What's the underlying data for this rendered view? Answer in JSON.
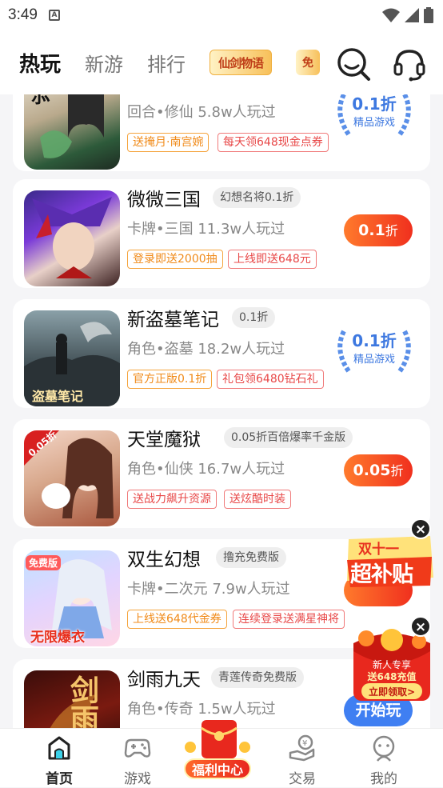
{
  "status_bar": {
    "time": "3:49"
  },
  "top_nav": {
    "tabs": [
      "热玩",
      "新游",
      "排行"
    ],
    "banner_1_text": "仙剑物语",
    "banner_2_text": "免"
  },
  "games": [
    {
      "name": "",
      "tag": "",
      "meta": "回合•修仙  5.8w人玩过",
      "promos": [
        "送掩月·南宫婉",
        "每天领648现金点券"
      ],
      "badge": {
        "value": "0.1折",
        "label": "精品游戏"
      }
    },
    {
      "name": "微微三国",
      "tag": "幻想名将0.1折",
      "meta": "卡牌•三国  11.3w人玩过",
      "promos": [
        "登录即送2000抽",
        "上线即送648元"
      ],
      "button": {
        "value": "0.1",
        "unit": "折"
      }
    },
    {
      "name": "新盗墓笔记",
      "tag": "0.1折",
      "meta": "角色•盗墓  18.2w人玩过",
      "promos": [
        "官方正版0.1折",
        "礼包领6480钻石礼"
      ],
      "badge": {
        "value": "0.1折",
        "label": "精品游戏"
      },
      "thumb_text": "盗墓笔记"
    },
    {
      "name": "天堂魔狱",
      "tag": "0.05折百倍爆率千金版",
      "meta": "角色•仙侠  16.7w人玩过",
      "promos": [
        "送战力飙升资源",
        "送炫酷时装"
      ],
      "button": {
        "value": "0.05",
        "unit": "折"
      },
      "thumb_text": "0.05折"
    },
    {
      "name": "双生幻想",
      "tag": "撸充免费版",
      "meta": "卡牌•二次元  7.9w人玩过",
      "promos": [
        "上线送648代金券",
        "连续登录送满星神将"
      ],
      "thumb_text": "免费版",
      "thumb_text_2": "无限爆衣"
    },
    {
      "name": "剑雨九天",
      "tag": "青莲传奇免费版",
      "meta": "角色•传奇  1.5w人玩过",
      "button_start": "开始玩",
      "thumb_text": "剑雨"
    }
  ],
  "float_ads": {
    "ad1": {
      "line1": "双十一",
      "line2": "超补贴"
    },
    "ad2": {
      "line1": "新人专享",
      "line2": "送648充值",
      "line3": "立即领取>"
    }
  },
  "bottom_nav": {
    "items": [
      "首页",
      "游戏",
      "交易",
      "我的"
    ],
    "welfare": "福利中心"
  },
  "colors": {
    "accent_red": "#f0301e",
    "accent_blue": "#3f7ff2",
    "promo_orange": "#f08a18"
  }
}
